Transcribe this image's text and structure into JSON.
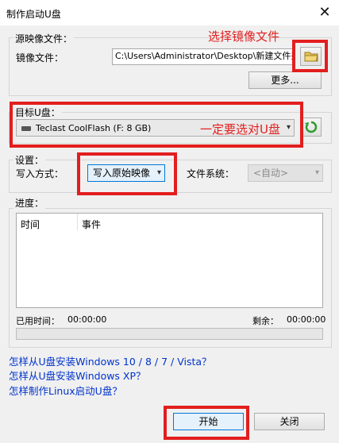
{
  "window": {
    "title": "制作启动U盘",
    "close_glyph": "✕"
  },
  "source": {
    "group_label": "源映像文件：",
    "image_label": "镜像文件：",
    "image_path": "C:\\Users\\Administrator\\Desktop\\新建文件夹\\W",
    "more_button": "更多..."
  },
  "target": {
    "group_label": "目标U盘：",
    "drive_value": "Teclast CoolFlash (F: 8 GB)"
  },
  "settings": {
    "group_label": "设置：",
    "write_mode_label": "写入方式：",
    "write_mode_value": "写入原始映像",
    "filesystem_label": "文件系统：",
    "filesystem_value": "<自动>"
  },
  "progress": {
    "group_label": "进度：",
    "columns": [
      "时间",
      "事件"
    ],
    "elapsed_label": "已用时间：",
    "elapsed_value": "00:00:00",
    "remaining_label": "剩余：",
    "remaining_value": "00:00:00",
    "fraction": 0
  },
  "links": [
    "怎样从U盘安装Windows 10 / 8 / 7 / Vista？",
    "怎样从U盘安装Windows XP？",
    "怎样制作Linux启动U盘？"
  ],
  "buttons": {
    "start": "开始",
    "close": "关闭"
  },
  "annotations": {
    "select_image": "选择镜像文件",
    "select_drive": "一定要选对U盘"
  },
  "colors": {
    "annotation_red": "#e31e1e",
    "link_blue": "#0033cc"
  }
}
